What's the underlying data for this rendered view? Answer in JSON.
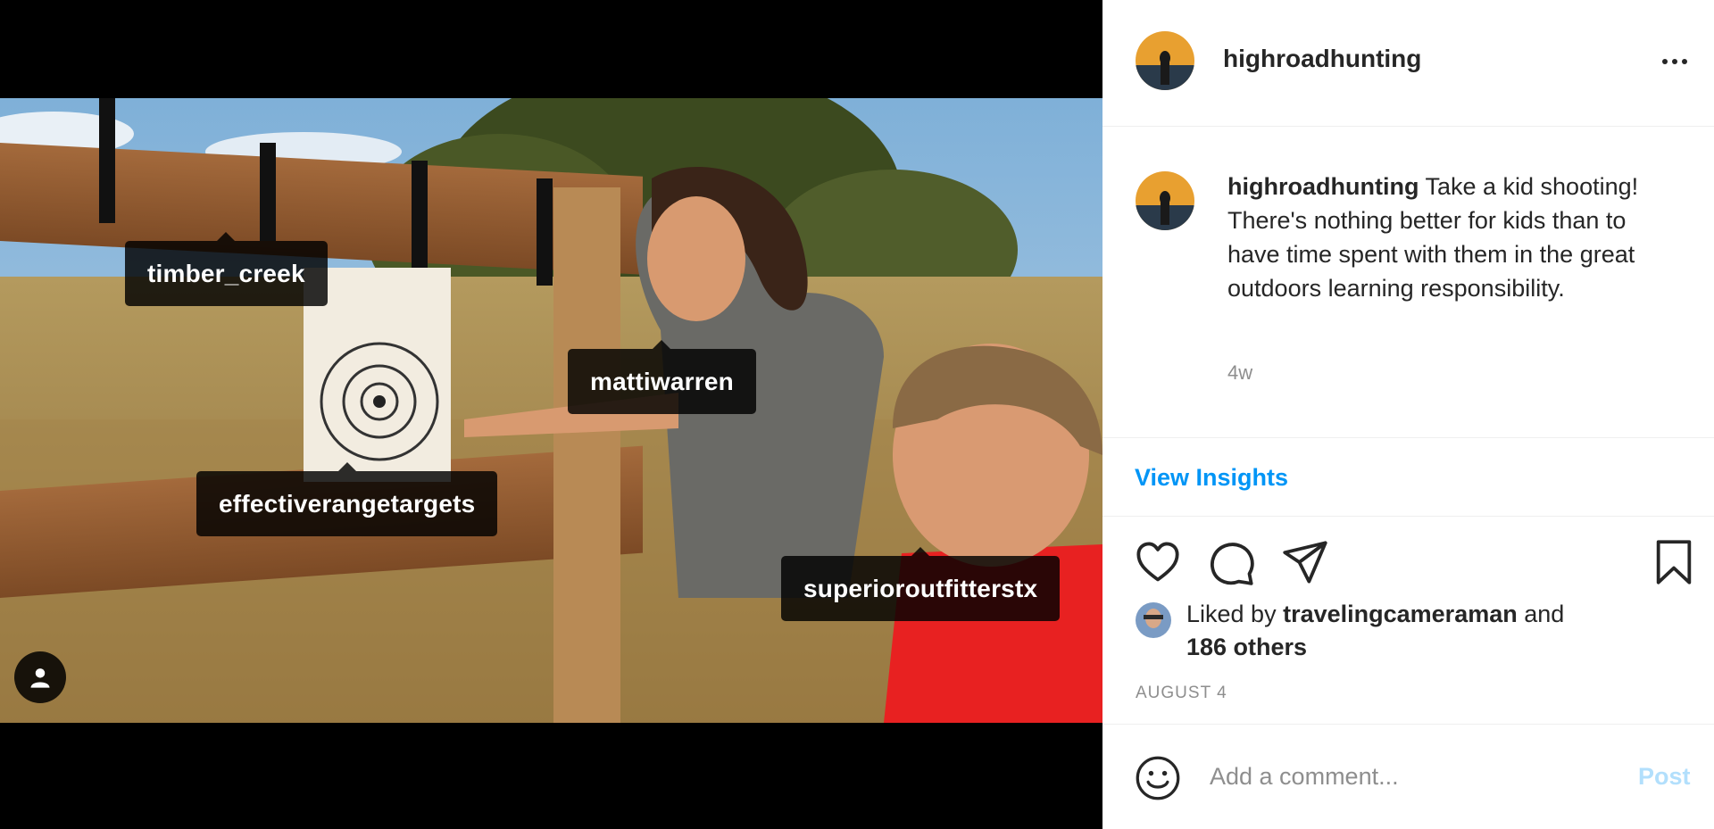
{
  "post": {
    "photo_tags": [
      {
        "username": "timber_creek"
      },
      {
        "username": "mattiwarren"
      },
      {
        "username": "effectiverangetargets"
      },
      {
        "username": "superioroutfitterstx"
      }
    ]
  },
  "header": {
    "username": "highroadhunting",
    "more_icon": "more-horizontal-icon"
  },
  "caption": {
    "username": "highroadhunting",
    "text": "Take a kid shooting! There's nothing better for kids than to have time spent with them in the great outdoors learning responsibility.",
    "time_ago": "4w"
  },
  "insights": {
    "label": "View Insights"
  },
  "actions": {
    "icons": [
      "heart-icon",
      "comment-icon",
      "share-icon",
      "bookmark-icon"
    ]
  },
  "likes": {
    "prefix": "Liked by",
    "first_user": "travelingcameraman",
    "joiner": "and",
    "others": "186 others"
  },
  "date": "AUGUST 4",
  "comment": {
    "placeholder": "Add a comment...",
    "post_label": "Post",
    "emoji_icon": "emoji-icon"
  },
  "colors": {
    "link": "#0095f6",
    "post_disabled": "#b2dffc",
    "text": "#262626",
    "muted": "#8e8e8e"
  }
}
